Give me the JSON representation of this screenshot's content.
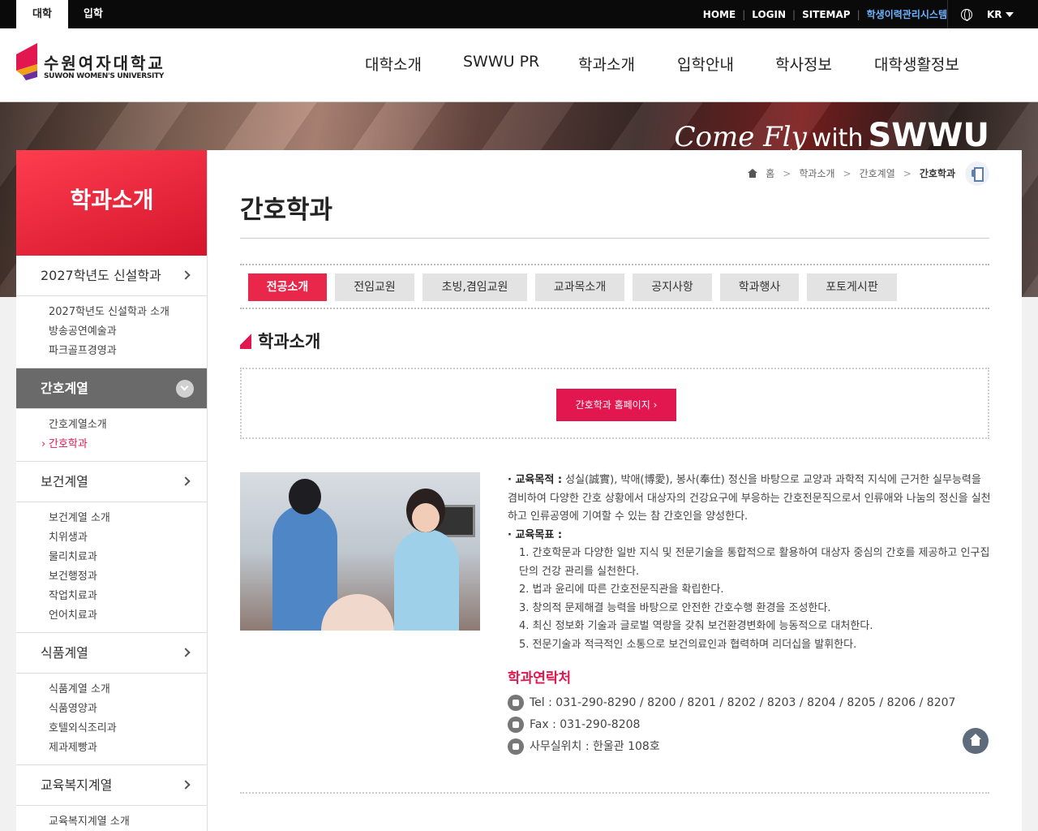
{
  "topbar": {
    "tabs": [
      "대학",
      "입학"
    ],
    "links": [
      "HOME",
      "LOGIN",
      "SITEMAP",
      "학생이력관리시스템"
    ],
    "lang": "KR"
  },
  "header": {
    "logo_ko": "수원여자대학교",
    "logo_en": "SUWON WOMEN'S UNIVERSITY",
    "nav": [
      "대학소개",
      "SWWU PR",
      "학과소개",
      "입학안내",
      "학사정보",
      "대학생활정보"
    ]
  },
  "banner": {
    "script": "Come Fly",
    "with": "with",
    "brand": "SWWU"
  },
  "sidebar": {
    "title": "학과소개",
    "groups": [
      {
        "label": "2027학년도 신설학과",
        "items": [
          "2027학년도 신설학과 소개",
          "방송공연예술과",
          "파크골프경영과"
        ]
      },
      {
        "label": "간호계열",
        "items": [
          "간호계열소개",
          "간호학과"
        ]
      },
      {
        "label": "보건계열",
        "items": [
          "보건계열 소개",
          "치위생과",
          "물리치료과",
          "보건행정과",
          "작업치료과",
          "언어치료과"
        ]
      },
      {
        "label": "식품계열",
        "items": [
          "식품계열 소개",
          "식품영양과",
          "호텔외식조리과",
          "제과제빵과"
        ]
      },
      {
        "label": "교육복지계열",
        "items": [
          "교육복지계열 소개"
        ]
      }
    ]
  },
  "breadcrumb": [
    "홈",
    "학과소개",
    "간호계열",
    "간호학과"
  ],
  "page": {
    "title": "간호학과",
    "tabs": [
      "전공소개",
      "전임교원",
      "초빙,겸임교원",
      "교과목소개",
      "공지사항",
      "학과행사",
      "포토게시판"
    ],
    "section1": "학과소개",
    "homepage_btn": "간호학과 홈페이지",
    "goal_label": "· 교육목적 :",
    "goal_text": " 성실(誠實), 박애(博愛), 봉사(奉仕) 정신을 바탕으로 교양과 과학적 지식에 근거한 실무능력을 겸비하여 다양한 간호 상황에서 대상자의 건강요구에 부응하는 간호전문직으로서 인류애와 나눔의 정신을 실천하고 인류공영에 기여할 수 있는 참 간호인을 양성한다.",
    "target_label": "· 교육목표 :",
    "targets": [
      "1. 간호학문과 다양한 일반 지식 및 전문기술을 통합적으로 활용하여 대상자 중심의 간호를 제공하고 인구집단의 건강 관리를 실천한다.",
      "2. 법과 윤리에 따른 간호전문직관을 확립한다.",
      "3. 창의적 문제해결 능력을 바탕으로 안전한 간호수행 환경을 조성한다.",
      "4. 최신 정보화 기술과 글로벌 역량을 갖춰 보건환경변화에 능동적으로 대처한다.",
      "5. 전문기술과 적극적인 소통으로 보건의료인과 협력하며 리더십을 발휘한다."
    ],
    "contact_title": "학과연락처",
    "tel": "Tel : 031-290-8290 / 8200 / 8201 / 8202 / 8203 / 8204 / 8205 / 8206 / 8207",
    "fax": "Fax : 031-290-8208",
    "office": "사무실위치 : 한울관 108호"
  },
  "colors": {
    "accent": "#e3174f",
    "sidebar_active": "#6a6a6a",
    "topbar": "#0a0a0a"
  }
}
